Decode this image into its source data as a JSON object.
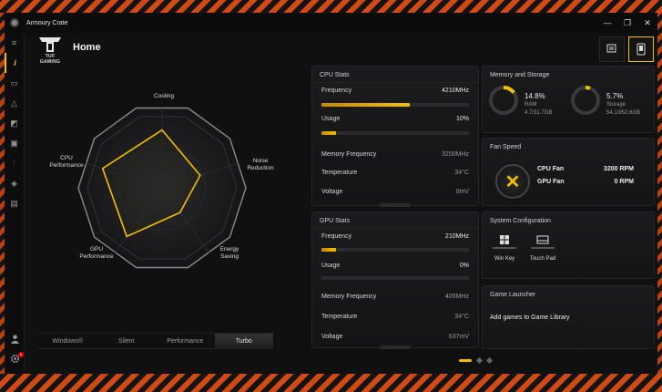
{
  "app": {
    "title": "Armoury Crate",
    "window_controls": [
      "—",
      "❐",
      "✕"
    ]
  },
  "brand": {
    "logo_text": "TUF GAMING"
  },
  "page": {
    "title": "Home"
  },
  "colors": {
    "accent": "#f2c000",
    "hazard": "#d14a16",
    "notification": "#e01010"
  },
  "sidebar": {
    "items": [
      {
        "icon": "menu-icon",
        "glyph": "≡"
      },
      {
        "icon": "info-icon",
        "glyph": "i"
      },
      {
        "icon": "device-icon",
        "glyph": "▭"
      },
      {
        "icon": "aura-icon",
        "glyph": "△"
      },
      {
        "icon": "game-visual-icon",
        "glyph": "◩"
      },
      {
        "icon": "gamepad-icon",
        "glyph": "▣"
      },
      {
        "icon": "sliders-icon",
        "glyph": "⫶"
      },
      {
        "icon": "tag-icon",
        "glyph": "◈"
      },
      {
        "icon": "news-icon",
        "glyph": "▤"
      }
    ],
    "user_icon": "user-icon",
    "settings_icon": "gear-icon",
    "settings_badge": "1"
  },
  "radar": {
    "labels": {
      "cooling": "Cooling",
      "noise": "Noise\nReduction",
      "energy": "Energy\nSaving",
      "gpu": "GPU\nPerformance",
      "cpu": "CPU\nPerformance"
    },
    "values": {
      "cooling": 0.72,
      "noise": 0.5,
      "energy": 0.38,
      "gpu": 0.75,
      "cpu": 0.78
    }
  },
  "modes": {
    "items": [
      "Windows®",
      "Silent",
      "Performance",
      "Turbo"
    ],
    "selected": "Turbo"
  },
  "cpu": {
    "title": "CPU Stats",
    "frequency_label": "Frequency",
    "frequency": "4210MHz",
    "frequency_level": 0.6,
    "usage_label": "Usage",
    "usage": "10%",
    "usage_level": 0.1,
    "memfreq_label": "Memory Frequency",
    "memfreq": "3200MHz",
    "temp_label": "Temperature",
    "temp": "34°C",
    "voltage_label": "Voltage",
    "voltage": "0mV"
  },
  "gpu": {
    "title": "GPU Stats",
    "frequency_label": "Frequency",
    "frequency": "210MHz",
    "frequency_level": 0.1,
    "usage_label": "Usage",
    "usage": "0%",
    "usage_level": 0.0,
    "memfreq_label": "Memory Frequency",
    "memfreq": "405MHz",
    "temp_label": "Temperature",
    "temp": "34°C",
    "voltage_label": "Voltage",
    "voltage": "637mV"
  },
  "memory": {
    "title": "Memory and Storage",
    "ram_pct": "14.8%",
    "ram_label": "RAM",
    "ram_detail": "4.7/31.7GB",
    "ram_level": 0.148,
    "storage_pct": "5.7%",
    "storage_label": "Storage",
    "storage_detail": "54.1/952.6GB",
    "storage_level": 0.057
  },
  "fan": {
    "title": "Fan Speed",
    "cpu_label": "CPU Fan",
    "cpu_rpm": "3200 RPM",
    "gpu_label": "GPU Fan",
    "gpu_rpm": "0 RPM"
  },
  "config": {
    "title": "System Configuration",
    "winkey_label": "Win Key",
    "touchpad_label": "Touch Pad"
  },
  "launcher": {
    "title": "Game Launcher",
    "message": "Add games to Game Library"
  }
}
